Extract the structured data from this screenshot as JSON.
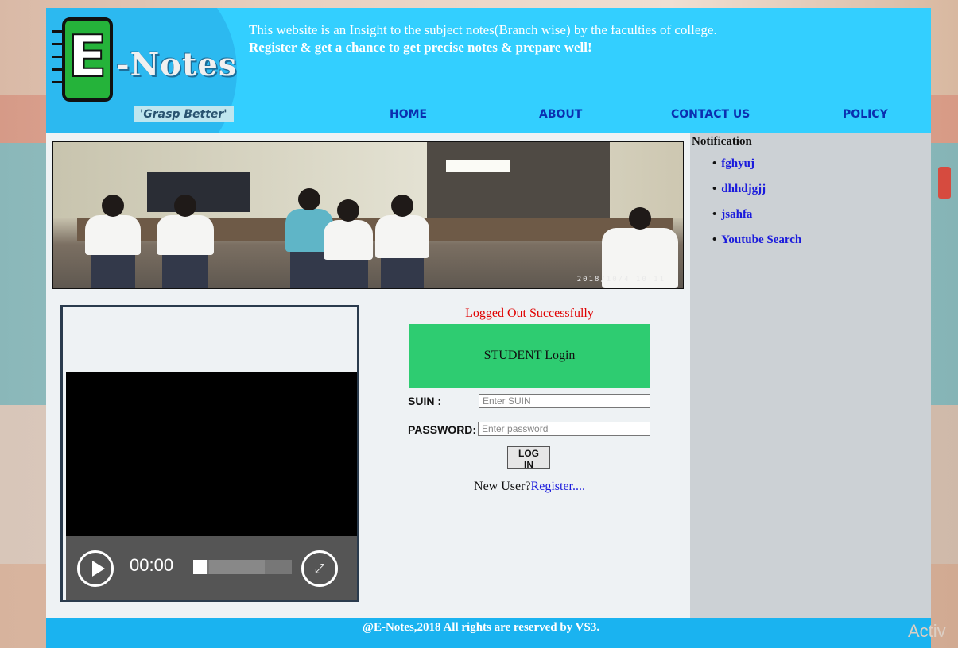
{
  "header": {
    "logo_text": "-Notes",
    "logo_letter": "E",
    "tagline": "'Grasp Better'",
    "intro_line1": "This website is an Insight to the subject notes(Branch wise) by the faculties of college.",
    "intro_line2": "Register & get a chance to get precise notes & prepare well!"
  },
  "nav": {
    "home": "HOME",
    "about": "ABOUT",
    "contact": "CONTACT US",
    "policy": "POLICY"
  },
  "banner": {
    "timestamp": "2018/10/4 10:11"
  },
  "video": {
    "time": "00:00",
    "progress": 0.14
  },
  "login": {
    "status": "Logged Out Successfully",
    "title": "STUDENT Login",
    "suin_label": "SUIN :",
    "suin_placeholder": "Enter SUIN",
    "password_label": "PASSWORD:",
    "password_placeholder": "Enter password",
    "button": "LOG IN",
    "new_user": "New User?",
    "register_link": "Register...."
  },
  "notifications": {
    "title": "Notification",
    "items": [
      "fghyuj",
      "dhhdjgjj",
      "jsahfa",
      "Youtube Search"
    ]
  },
  "footer": {
    "text": "@E-Notes,2018 All rights are reserved by VS3."
  },
  "overlay": {
    "activate": "Activ"
  },
  "colors": {
    "header": "#33cfff",
    "footer": "#1ab3f0",
    "login_header": "#2ecc71",
    "status": "#e00000",
    "link": "#1a1adc"
  }
}
